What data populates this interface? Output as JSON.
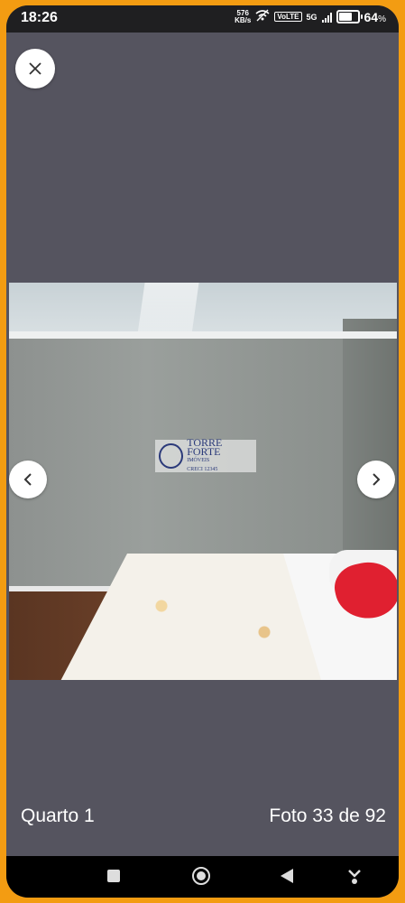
{
  "status_bar": {
    "time": "18:26",
    "net_speed_value": "576",
    "net_speed_unit": "KB/s",
    "lte_badge": "VoLTE",
    "network_type": "5G",
    "battery_percent": "64",
    "battery_suffix": "%",
    "battery_level": 0.64
  },
  "viewer": {
    "close_icon": "close-icon",
    "photo_watermark": {
      "line1": "TORRE FORTE",
      "line2": "IMÓVEIS",
      "line3": "CRECI 12345"
    },
    "prev_icon": "chevron-left-icon",
    "next_icon": "chevron-right-icon",
    "caption": "Quarto 1",
    "counter": "Foto 33 de 92"
  },
  "nav_bar": {
    "recents_icon": "square-icon",
    "home_icon": "circle-icon",
    "back_icon": "triangle-back-icon",
    "extra_icon": "download-icon"
  },
  "colors": {
    "frame_border": "#f39c12",
    "background": "#55545f"
  }
}
